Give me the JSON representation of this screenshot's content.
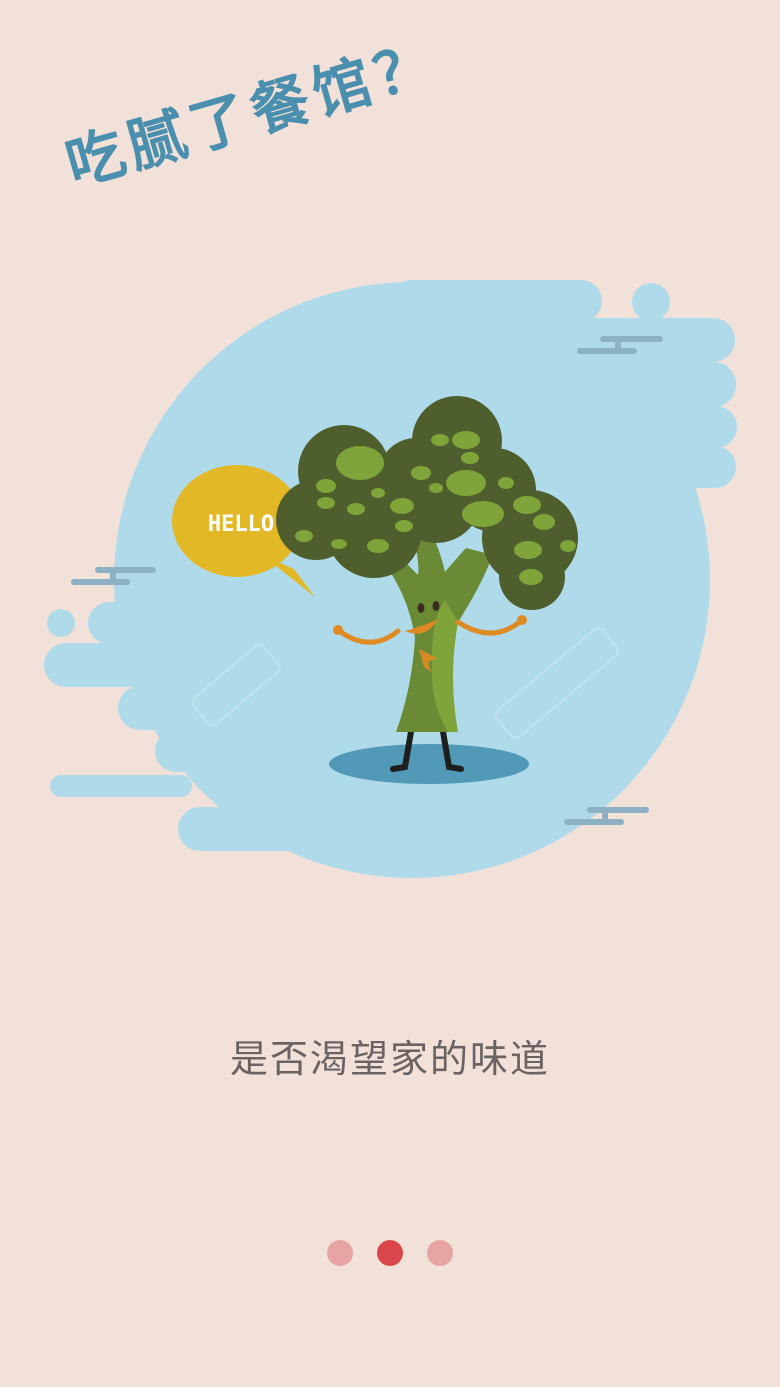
{
  "colors": {
    "background": "#f2e1d9",
    "headline": "#4a8fae",
    "blob": "#afdaea",
    "cloud_line": "#8db0c4",
    "broccoli_dark": "#4f5e2d",
    "broccoli_light": "#7ea43a",
    "stem": "#6a8a35",
    "bubble": "#e3b826",
    "bubble_text": "#ffffff",
    "arms": "#e08a23",
    "shadow": "#5199b6",
    "tagline": "#6b6363",
    "dot_inactive": "#e6a5a3",
    "dot_active": "#d9474b"
  },
  "onboarding": {
    "headline": "吃腻了餐馆？",
    "tagline": "是否渴望家的味道",
    "illustration": {
      "speech_bubble": "HELLO",
      "character": "broccoli-character"
    },
    "pager": {
      "total_pages": 3,
      "current_page": 2
    }
  }
}
